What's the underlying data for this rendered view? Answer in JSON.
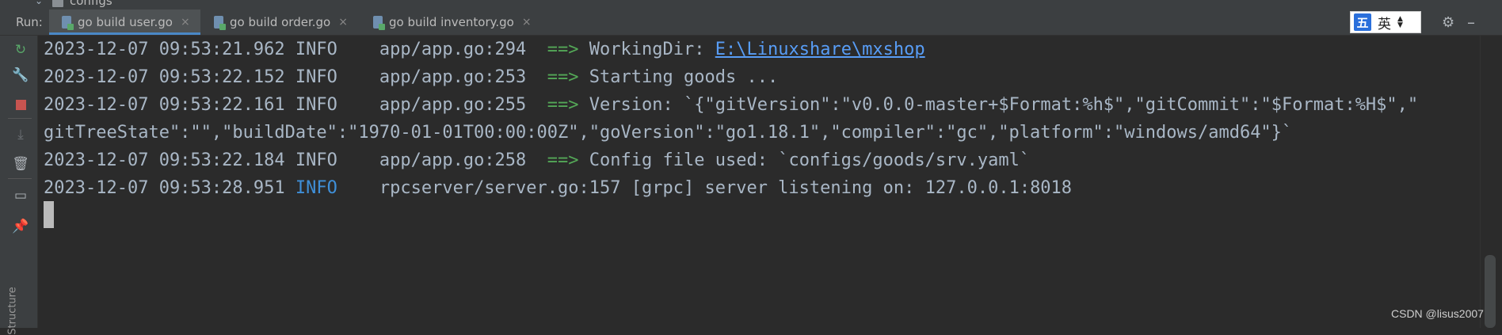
{
  "tree_row": {
    "item_label": "configs"
  },
  "run_panel": {
    "label": "Run:",
    "tabs": [
      {
        "label": "go build user.go",
        "active": true
      },
      {
        "label": "go build order.go",
        "active": false
      },
      {
        "label": "go build inventory.go",
        "active": false
      }
    ],
    "close_glyph": "×"
  },
  "ime": {
    "mode_char": "五",
    "lang_char": "英"
  },
  "left_toolbar_icons": [
    "rerun-icon",
    "wrench-icon",
    "stop-icon",
    "scroll-to-end-icon",
    "trash-icon",
    "layout-icon",
    "pin-icon"
  ],
  "side_label": "Structure",
  "console": {
    "lines": [
      {
        "date": "2023-12-07 09:53:21.962",
        "level": "INFO",
        "source": "app/app.go:294",
        "arrow": "==>",
        "message": "WorkingDir: ",
        "link": "E:\\Linuxshare\\mxshop"
      },
      {
        "date": "2023-12-07 09:53:22.152",
        "level": "INFO",
        "source": "app/app.go:253",
        "arrow": "==>",
        "message": "Starting goods ..."
      },
      {
        "date": "2023-12-07 09:53:22.161",
        "level": "INFO",
        "source": "app/app.go:255",
        "arrow": "==>",
        "message": "Version: `{\"gitVersion\":\"v0.0.0-master+$Format:%h$\",\"gitCommit\":\"$Format:%H$\",\"",
        "continuation": "gitTreeState\":\"\",\"buildDate\":\"1970-01-01T00:00:00Z\",\"goVersion\":\"go1.18.1\",\"compiler\":\"gc\",\"platform\":\"windows/amd64\"}`"
      },
      {
        "date": "2023-12-07 09:53:22.184",
        "level": "INFO",
        "source": "app/app.go:258",
        "arrow": "==>",
        "message": "Config file used: `configs/goods/srv.yaml`"
      },
      {
        "date": "2023-12-07 09:53:28.951",
        "level": "INFO",
        "source": "rpcserver/server.go:157",
        "message": "[grpc] server listening on: 127.0.0.1:8018"
      }
    ]
  },
  "watermark": "CSDN @lisus2007",
  "colors": {
    "background": "#2b2b2b",
    "toolbar": "#3c3f41",
    "arrow": "#54a857",
    "info_blue": "#3f8fd8",
    "link": "#589df6",
    "stop": "#c75450"
  }
}
